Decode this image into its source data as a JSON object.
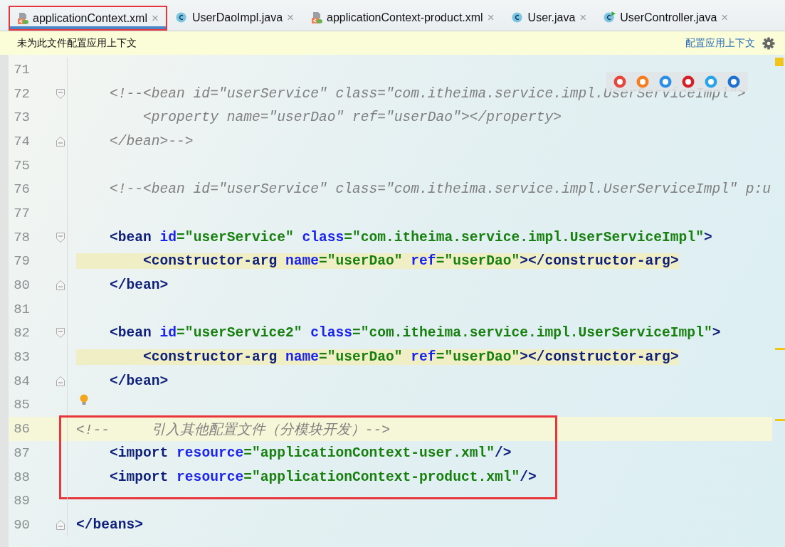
{
  "tabs": [
    {
      "label": "applicationContext.xml",
      "kind": "xml",
      "selected": true,
      "annotated": true,
      "close": "×"
    },
    {
      "label": "UserDaoImpl.java",
      "kind": "class",
      "selected": false,
      "annotated": false,
      "close": "×"
    },
    {
      "label": "applicationContext-product.xml",
      "kind": "xml",
      "selected": false,
      "annotated": false,
      "close": "×"
    },
    {
      "label": "User.java",
      "kind": "class",
      "selected": false,
      "annotated": false,
      "close": "×"
    },
    {
      "label": "UserController.java",
      "kind": "runnable",
      "selected": false,
      "annotated": false,
      "close": "×"
    }
  ],
  "notification": {
    "message": "未为此文件配置应用上下文",
    "link": "配置应用上下文"
  },
  "browser_icons": [
    {
      "color": "#e8453c"
    },
    {
      "color": "#f57c1f"
    },
    {
      "color": "#2f8fe8"
    },
    {
      "color": "#d5202a"
    },
    {
      "color": "#2aa4e8"
    },
    {
      "color": "#1f72d0"
    }
  ],
  "sections": [
    {
      "boxed": false,
      "lines": [
        {
          "number": "71",
          "current": false
        },
        {
          "number": "72",
          "fold_marker": {
            "kind": "start"
          },
          "current": false,
          "tag_highlight": false,
          "tokens": [
            {
              "t": "    <!--<bean id=\"userService\" class=\"com.itheima.service.impl.UserServiceImpl\">",
              "kind": "comment"
            }
          ]
        },
        {
          "number": "73",
          "current": false,
          "tag_highlight": false,
          "tokens": [
            {
              "t": "        <property name=\"userDao\" ref=\"userDao\"></property>",
              "kind": "comment"
            }
          ]
        },
        {
          "number": "74",
          "fold_marker": {
            "kind": "end"
          },
          "current": false,
          "tag_highlight": false,
          "tokens": [
            {
              "t": "    </bean>-->",
              "kind": "comment"
            }
          ]
        },
        {
          "number": "75",
          "current": false
        },
        {
          "number": "76",
          "current": false,
          "tag_highlight": false,
          "tokens": [
            {
              "t": "    <!--<bean id=\"userService\" class=\"com.itheima.service.impl.UserServiceImpl\" p:u",
              "kind": "comment"
            }
          ]
        },
        {
          "number": "77",
          "current": false
        },
        {
          "number": "78",
          "fold_marker": {
            "kind": "start"
          },
          "current": false,
          "tag_highlight": false,
          "tokens": [
            {
              "t": "    <bean",
              "kind": "tag"
            },
            {
              "t": " id",
              "kind": "attr"
            },
            {
              "t": "=\"userService\"",
              "kind": "value"
            },
            {
              "t": " class",
              "kind": "attr"
            },
            {
              "t": "=\"com.itheima.service.impl.UserServiceImpl\"",
              "kind": "value"
            },
            {
              "t": ">",
              "kind": "tag"
            }
          ]
        },
        {
          "number": "79",
          "current": false,
          "tag_highlight": true,
          "tokens": [
            {
              "t": "        <constructor-arg",
              "kind": "tag"
            },
            {
              "t": " name",
              "kind": "attr"
            },
            {
              "t": "=\"userDao\"",
              "kind": "value"
            },
            {
              "t": " ref",
              "kind": "attr"
            },
            {
              "t": "=\"userDao\"",
              "kind": "value"
            },
            {
              "t": "></constructor-arg>",
              "kind": "tag"
            }
          ]
        },
        {
          "number": "80",
          "fold_marker": {
            "kind": "end"
          },
          "current": false,
          "tag_highlight": false,
          "tokens": [
            {
              "t": "    </bean>",
              "kind": "tag"
            }
          ]
        },
        {
          "number": "81",
          "current": false
        },
        {
          "number": "82",
          "fold_marker": {
            "kind": "start"
          },
          "current": false,
          "tag_highlight": false,
          "tokens": [
            {
              "t": "    <bean",
              "kind": "tag"
            },
            {
              "t": " id",
              "kind": "attr"
            },
            {
              "t": "=\"userService2\"",
              "kind": "value"
            },
            {
              "t": " class",
              "kind": "attr"
            },
            {
              "t": "=\"com.itheima.service.impl.UserServiceImpl\"",
              "kind": "value"
            },
            {
              "t": ">",
              "kind": "tag"
            }
          ]
        },
        {
          "number": "83",
          "current": false,
          "tag_highlight": true,
          "tokens": [
            {
              "t": "        <constructor-arg",
              "kind": "tag"
            },
            {
              "t": " name",
              "kind": "attr"
            },
            {
              "t": "=\"userDao\"",
              "kind": "value"
            },
            {
              "t": " ref",
              "kind": "attr"
            },
            {
              "t": "=\"userDao\"",
              "kind": "value"
            },
            {
              "t": "></constructor-arg>",
              "kind": "tag"
            }
          ]
        },
        {
          "number": "84",
          "fold_marker": {
            "kind": "end"
          },
          "current": false,
          "tag_highlight": false,
          "tokens": [
            {
              "t": "    </bean>",
              "kind": "tag"
            }
          ]
        },
        {
          "number": "85",
          "current": false,
          "bulb": true
        }
      ]
    },
    {
      "boxed": true,
      "lines": [
        {
          "number": "86",
          "current": true,
          "tag_highlight": false,
          "tokens": [
            {
              "t": "<!--     引入其他配置文件（分模块开发）-->",
              "kind": "comment"
            }
          ]
        },
        {
          "number": "87",
          "current": false,
          "tag_highlight": false,
          "tokens": [
            {
              "t": "    <import",
              "kind": "tag"
            },
            {
              "t": " resource",
              "kind": "attr"
            },
            {
              "t": "=\"applicationContext-user.xml\"",
              "kind": "value"
            },
            {
              "t": "/>",
              "kind": "tag"
            }
          ]
        },
        {
          "number": "88",
          "current": false,
          "tag_highlight": false,
          "tokens": [
            {
              "t": "    <import",
              "kind": "tag"
            },
            {
              "t": " resource",
              "kind": "attr"
            },
            {
              "t": "=\"applicationContext-product.xml\"",
              "kind": "value"
            },
            {
              "t": "/>",
              "kind": "tag"
            }
          ]
        }
      ]
    },
    {
      "boxed": false,
      "lines": [
        {
          "number": "89",
          "current": false
        },
        {
          "number": "90",
          "fold_marker": {
            "kind": "end"
          },
          "current": false,
          "tag_highlight": false,
          "tokens": [
            {
              "t": "</beans>",
              "kind": "tag"
            }
          ]
        }
      ]
    }
  ]
}
